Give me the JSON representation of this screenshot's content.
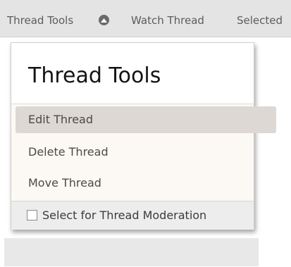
{
  "toolbar": {
    "thread_tools_label": "Thread Tools",
    "watch_thread_label": "Watch Thread",
    "selected_label": "Selected",
    "arrow_icon": "chevron-up-icon"
  },
  "popup": {
    "title": "Thread Tools",
    "items": [
      {
        "label": "Edit Thread"
      },
      {
        "label": "Delete Thread"
      },
      {
        "label": "Move Thread"
      }
    ],
    "footer": {
      "checkbox_label": "Select for Thread Moderation",
      "checked": false
    }
  },
  "colors": {
    "toolbar_bg": "#e4e4e4",
    "popup_bg": "#fcf9f4",
    "hover_bg": "#ddd8d4",
    "footer_bg": "#ededed"
  }
}
